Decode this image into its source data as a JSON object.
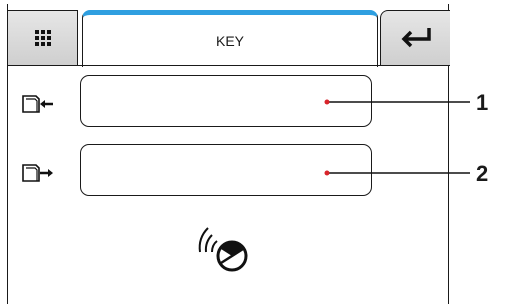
{
  "header": {
    "title": "KEY",
    "accent_color": "#2f9fe0",
    "menu_icon": "grid-icon",
    "enter_icon": "enter-return-icon"
  },
  "fields": [
    {
      "icon": "door-in-arrow-icon",
      "value": "",
      "callout": "1"
    },
    {
      "icon": "door-out-arrow-icon",
      "value": "",
      "callout": "2"
    }
  ],
  "rfid_icon": "rfid-tag-icon",
  "callout_color": "#d9242b"
}
